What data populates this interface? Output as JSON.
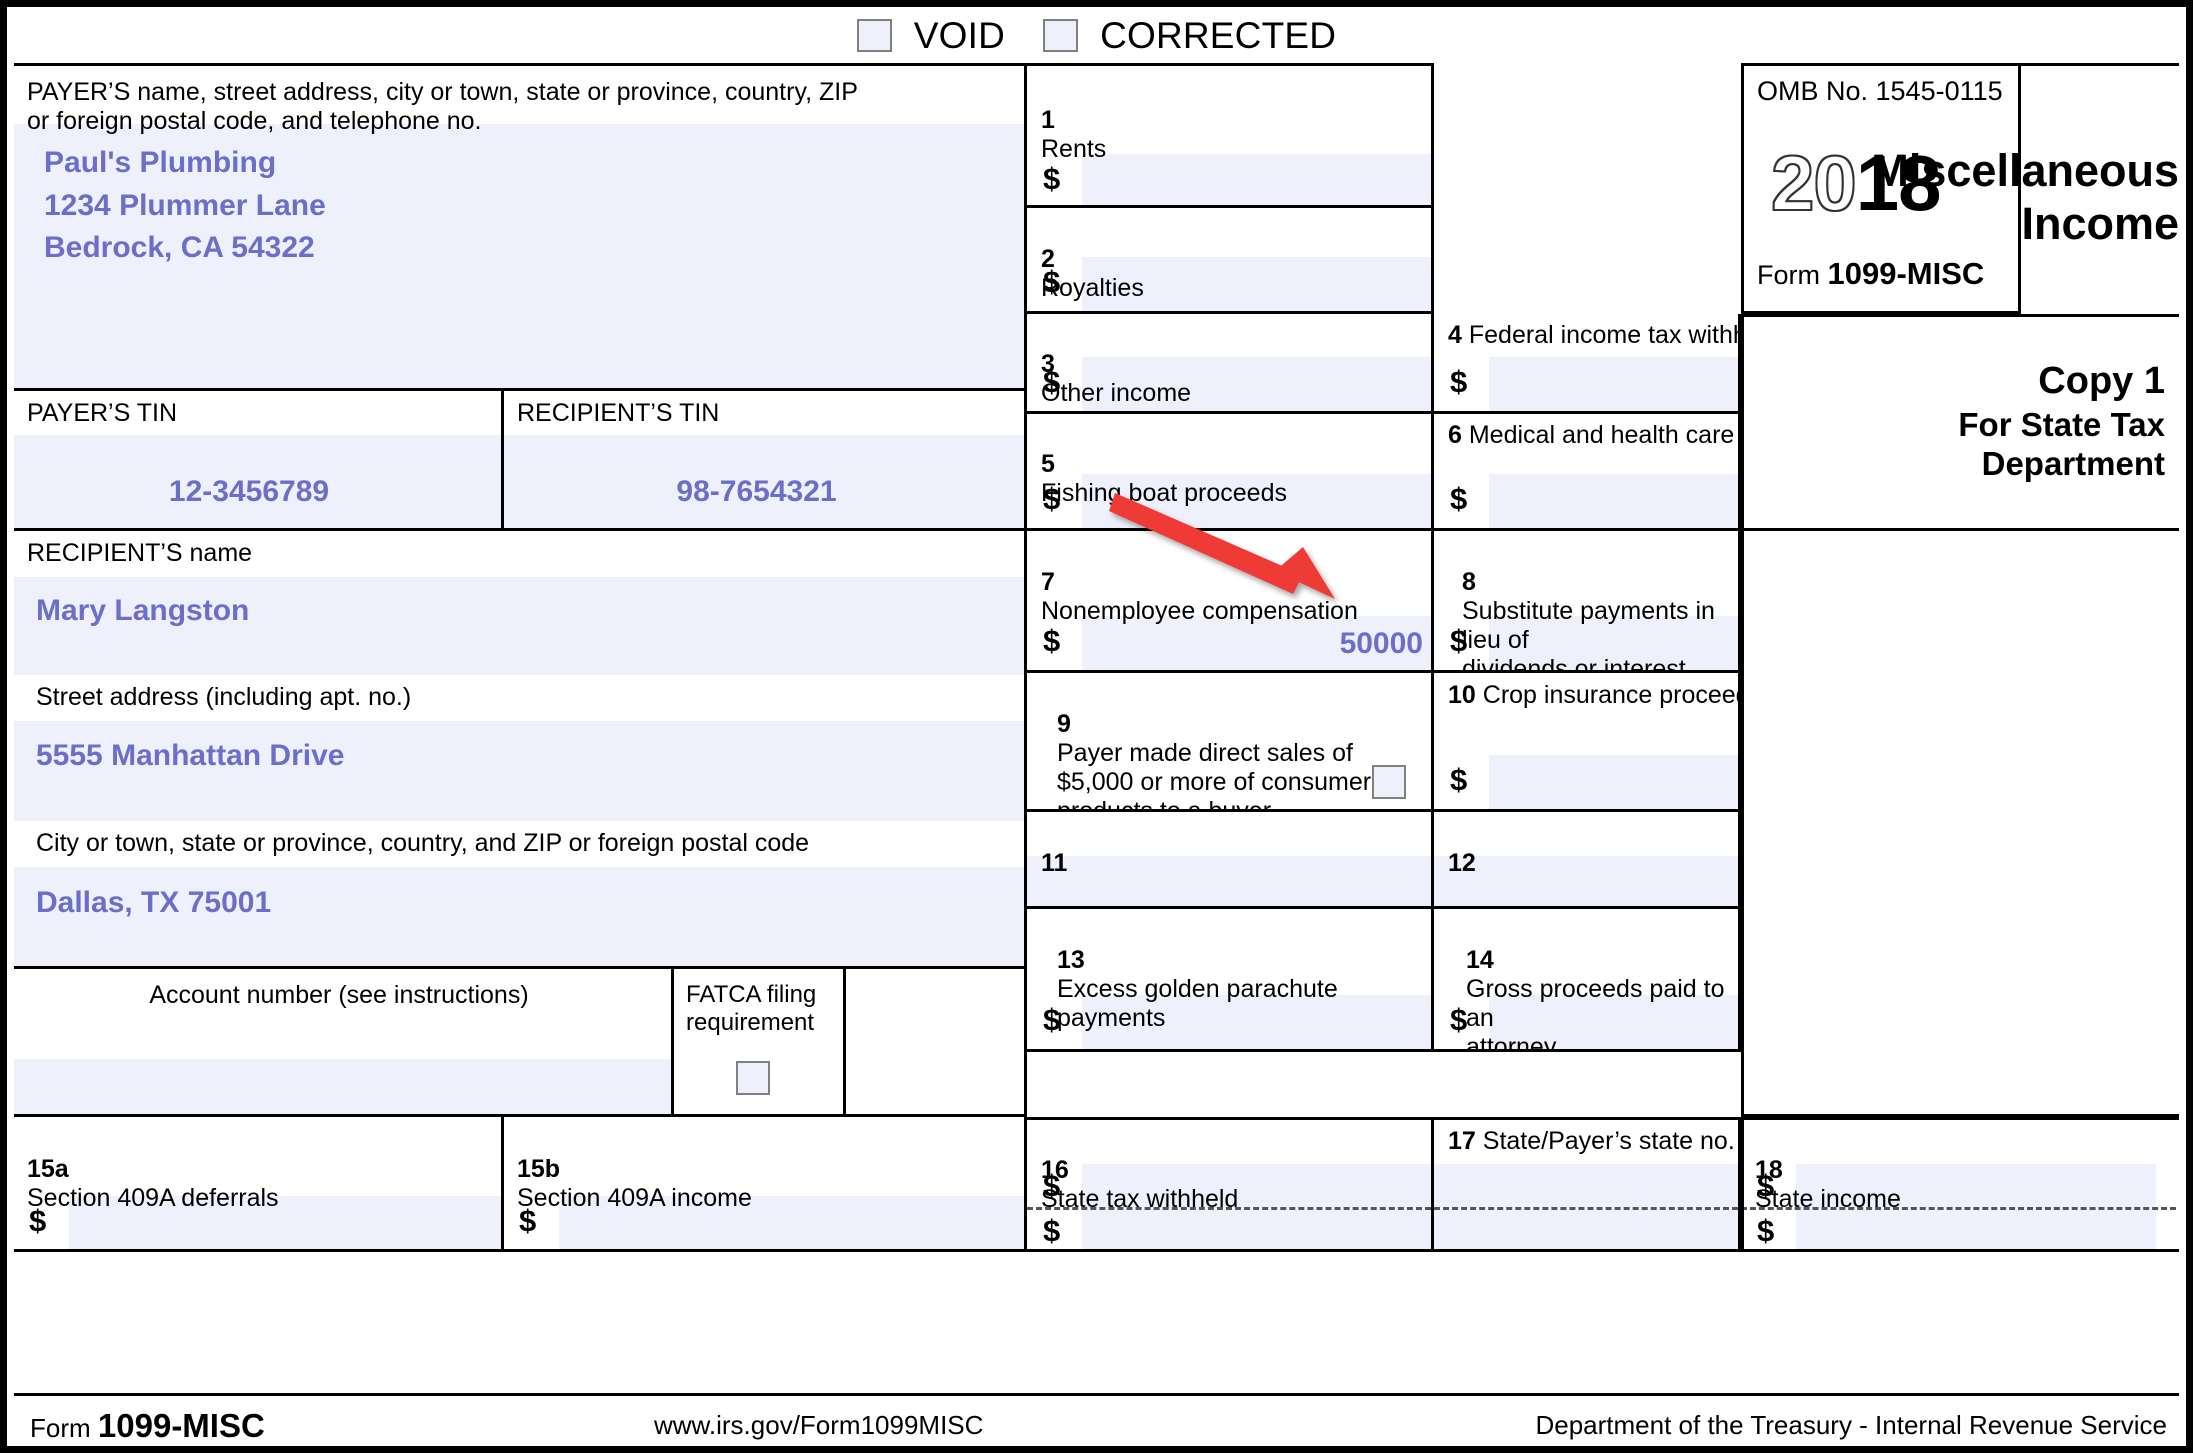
{
  "form": {
    "top_checkboxes": [
      {
        "label": "VOID",
        "checked": false
      },
      {
        "label": "CORRECTED",
        "checked": false
      }
    ],
    "omb": "OMB No. 1545-0115",
    "year_light": "20",
    "year_bold": "18",
    "form_word": "Form",
    "form_number": "1099-MISC",
    "title": "Miscellaneous\nIncome",
    "copy_line1": "Copy 1",
    "copy_line2": "For State Tax\nDepartment",
    "footer_form_word": "Form",
    "footer_form_number": "1099-MISC",
    "footer_url": "www.irs.gov/Form1099MISC",
    "footer_dept": "Department of the Treasury - Internal Revenue Service",
    "dollar_sign": "$",
    "arrow_marker": "▶"
  },
  "payer": {
    "label": "PAYER’S name, street address, city or town, state or province, country, ZIP\nor foreign postal code, and telephone no.",
    "value": "Paul's Plumbing\n1234 Plummer Lane\nBedrock, CA 54322",
    "tin_label": "PAYER’S TIN",
    "tin_value": "12-3456789"
  },
  "recipient": {
    "tin_label": "RECIPIENT’S TIN",
    "tin_value": "98-7654321",
    "name_label": "RECIPIENT’S name",
    "name_value": "Mary Langston",
    "street_label": "Street address (including apt. no.)",
    "street_value": "5555 Manhattan Drive",
    "city_label": "City or town, state or province, country, and ZIP or foreign postal code",
    "city_value": "Dallas, TX 75001"
  },
  "account": {
    "label": "Account number (see instructions)",
    "value": "",
    "fatca_label": "FATCA filing\nrequirement",
    "fatca_checked": false
  },
  "boxes": {
    "b1": {
      "num": "1",
      "label": "Rents",
      "value": ""
    },
    "b2": {
      "num": "2",
      "label": "Royalties",
      "value": ""
    },
    "b3": {
      "num": "3",
      "label": "Other income",
      "value": ""
    },
    "b4": {
      "num": "4",
      "label": "Federal income tax withheld",
      "value": ""
    },
    "b5": {
      "num": "5",
      "label": "Fishing boat proceeds",
      "value": ""
    },
    "b6": {
      "num": "6",
      "label": "Medical and health care payments",
      "value": ""
    },
    "b7": {
      "num": "7",
      "label": "Nonemployee compensation",
      "value": "50000"
    },
    "b8": {
      "num": "8",
      "label": "Substitute payments in lieu of\ndividends or interest",
      "value": ""
    },
    "b9": {
      "num": "9",
      "label": "Payer made direct sales of\n$5,000 or more of consumer\nproducts to a buyer\n(recipient) for resale ▶",
      "checked": false
    },
    "b10": {
      "num": "10",
      "label": "Crop insurance proceeds",
      "value": ""
    },
    "b11": {
      "num": "11",
      "label": "",
      "value": ""
    },
    "b12": {
      "num": "12",
      "label": "",
      "value": ""
    },
    "b13": {
      "num": "13",
      "label": "Excess golden parachute\npayments",
      "value": ""
    },
    "b14": {
      "num": "14",
      "label": "Gross proceeds paid to an\nattorney",
      "value": ""
    },
    "b15a": {
      "num": "15a",
      "label": "Section 409A deferrals",
      "value": ""
    },
    "b15b": {
      "num": "15b",
      "label": "Section 409A income",
      "value": ""
    },
    "b16": {
      "num": "16",
      "label": "State tax withheld",
      "value_top": "",
      "value_bottom": ""
    },
    "b17": {
      "num": "17",
      "label": "State/Payer’s state no.",
      "value_top": "",
      "value_bottom": ""
    },
    "b18": {
      "num": "18",
      "label": "State income",
      "value_top": "",
      "value_bottom": ""
    }
  },
  "annotation": {
    "arrow_color": "#ef3b36",
    "points_to": "b7-value"
  },
  "colors": {
    "entry_text": "#6b6fc8",
    "entry_field_bg": "#eef0fb",
    "border": "#000000"
  }
}
